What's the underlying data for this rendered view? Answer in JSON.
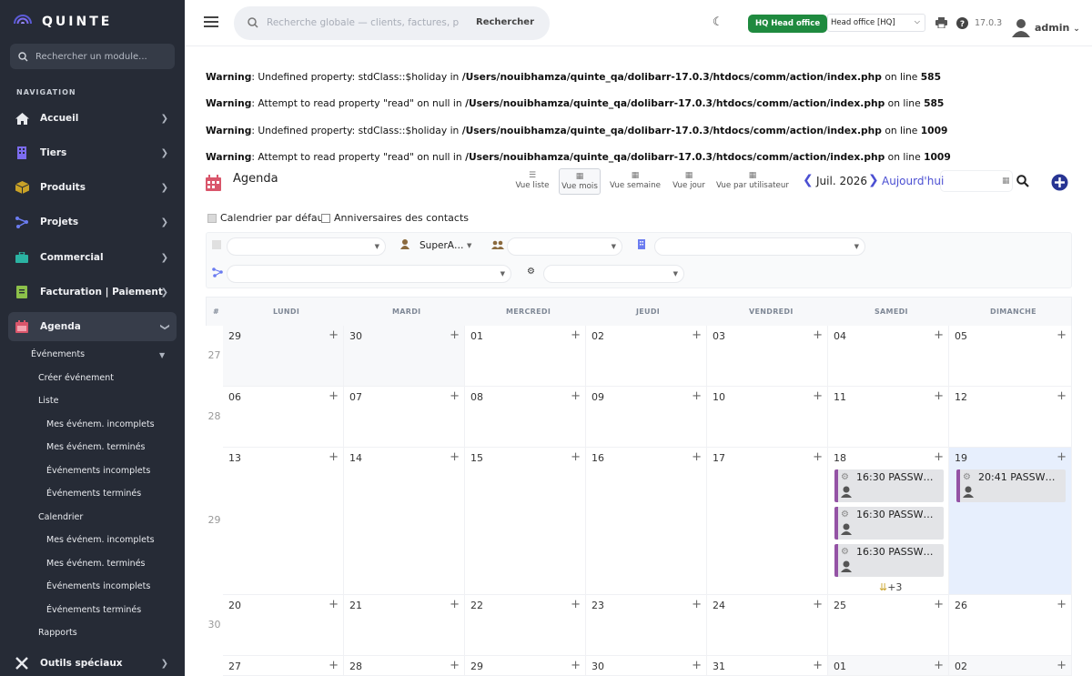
{
  "sidebar": {
    "logo_text": "QUINTE",
    "search_placeholder": "Rechercher un module...",
    "nav_label": "NAVIGATION",
    "items": [
      {
        "label": "Accueil",
        "icon": "home-icon"
      },
      {
        "label": "Tiers",
        "icon": "building-icon"
      },
      {
        "label": "Produits",
        "icon": "box-icon"
      },
      {
        "label": "Projets",
        "icon": "project-icon"
      },
      {
        "label": "Commercial",
        "icon": "briefcase-icon"
      },
      {
        "label": "Facturation | Paiement",
        "icon": "invoice-icon"
      },
      {
        "label": "Agenda",
        "icon": "calendar-icon"
      },
      {
        "label": "Outils spéciaux",
        "icon": "tools-icon"
      }
    ],
    "sub": {
      "evenements": "Événements",
      "creer": "Créer événement",
      "liste": "Liste",
      "liste_items": [
        "Mes événem. incomplets",
        "Mes événem. terminés",
        "Événements incomplets",
        "Événements terminés"
      ],
      "calendrier": "Calendrier",
      "calendrier_items": [
        "Mes événem. incomplets",
        "Mes événem. terminés",
        "Événements incomplets",
        "Événements terminés"
      ],
      "rapports": "Rapports"
    }
  },
  "topbar": {
    "search_placeholder": "Recherche globale — clients, factures, prod",
    "search_button": "Rechercher",
    "hq_badge": "HQ  Head office",
    "company_select": "Head office [HQ]",
    "version": "17.0.3",
    "user": "admin"
  },
  "warnings": [
    {
      "label": "Warning",
      "msg": ": Undefined property: stdClass::$holiday in ",
      "path": "/Users/nouibhamza/quinte_qa/dolibarr-17.0.3/htdocs/comm/action/index.php",
      "on": " on line ",
      "line": "585"
    },
    {
      "label": "Warning",
      "msg": ": Attempt to read property \"read\" on null in ",
      "path": "/Users/nouibhamza/quinte_qa/dolibarr-17.0.3/htdocs/comm/action/index.php",
      "on": " on line ",
      "line": "585"
    },
    {
      "label": "Warning",
      "msg": ": Undefined property: stdClass::$holiday in ",
      "path": "/Users/nouibhamza/quinte_qa/dolibarr-17.0.3/htdocs/comm/action/index.php",
      "on": " on line ",
      "line": "1009"
    },
    {
      "label": "Warning",
      "msg": ": Attempt to read property \"read\" on null in ",
      "path": "/Users/nouibhamza/quinte_qa/dolibarr-17.0.3/htdocs/comm/action/index.php",
      "on": " on line ",
      "line": "1009"
    }
  ],
  "agenda": {
    "title": "Agenda",
    "views": [
      "Vue liste",
      "Vue mois",
      "Vue semaine",
      "Vue jour",
      "Vue par utilisateur"
    ],
    "selected_view": "Vue mois",
    "month": "Juil. 2026",
    "today": "Aujourd'hui",
    "cb_default": "Calendrier par défaut",
    "cb_birthdays": "Anniversaires des contacts",
    "filter_user": "SuperA…"
  },
  "calendar": {
    "week_col": "#",
    "days": [
      "LUNDI",
      "MARDI",
      "MERCREDI",
      "JEUDI",
      "VENDREDI",
      "SAMEDI",
      "DIMANCHE"
    ],
    "weeks": [
      {
        "no": "27",
        "dates": [
          "29",
          "30",
          "01",
          "02",
          "03",
          "04",
          "05"
        ]
      },
      {
        "no": "28",
        "dates": [
          "06",
          "07",
          "08",
          "09",
          "10",
          "11",
          "12"
        ]
      },
      {
        "no": "29",
        "dates": [
          "13",
          "14",
          "15",
          "16",
          "17",
          "18",
          "19"
        ]
      },
      {
        "no": "30",
        "dates": [
          "20",
          "21",
          "22",
          "23",
          "24",
          "25",
          "26"
        ]
      },
      {
        "no": "",
        "dates": [
          "27",
          "28",
          "29",
          "30",
          "31",
          "01",
          "02"
        ]
      }
    ],
    "events_sat": [
      "16:30 PASSW…",
      "16:30 PASSW…",
      "16:30 PASSW…"
    ],
    "events_sun": [
      "20:41 PASSW…"
    ],
    "more": "+3"
  }
}
